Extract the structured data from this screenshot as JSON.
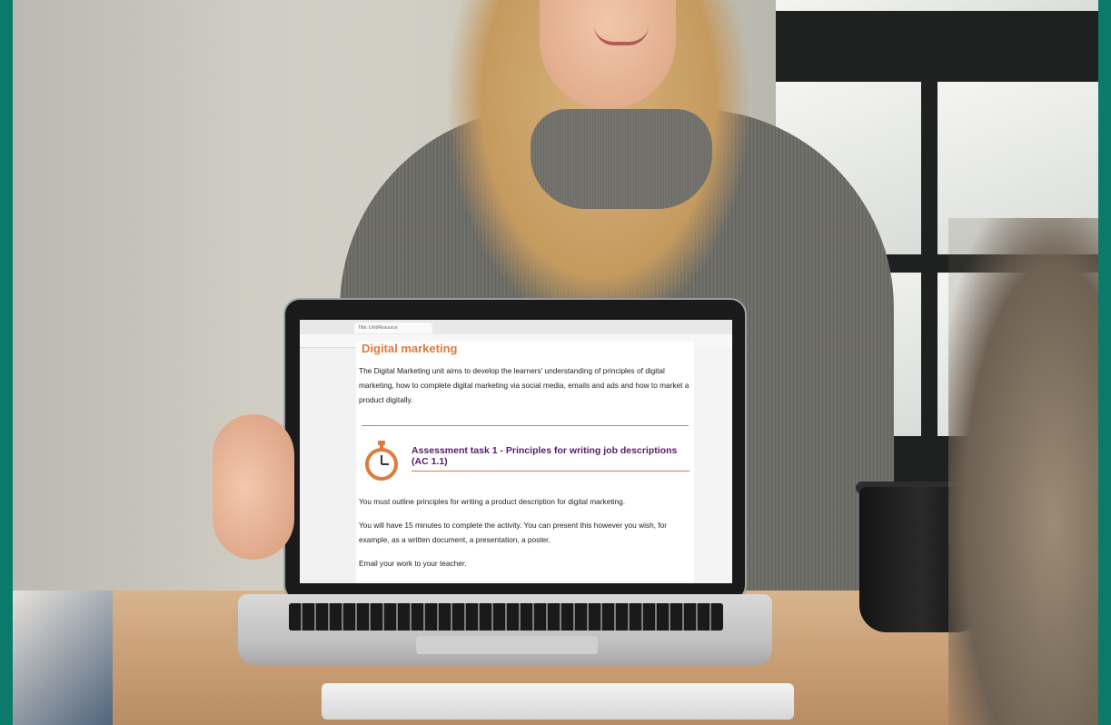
{
  "browser": {
    "tab_label": "Title: Unit/Resource"
  },
  "document": {
    "title": "Digital marketing",
    "intro": "The Digital Marketing unit aims to develop the learners' understanding of principles of digital marketing, how to complete digital marketing via social media, emails and ads and how to market a product digitally.",
    "task_title": "Assessment task 1 - Principles for writing job descriptions (AC 1.1)",
    "paragraphs": [
      "You must outline principles for writing a product description for digital marketing.",
      "You will have 15 minutes to complete the activity. You can present this however you wish, for example, as a written document, a presentation, a poster.",
      "Email your work to your teacher."
    ],
    "icon": "stopwatch-icon"
  },
  "colors": {
    "frame": "#0b7a6b",
    "title_orange": "#e07a3c",
    "task_purple": "#5a1a6c"
  }
}
